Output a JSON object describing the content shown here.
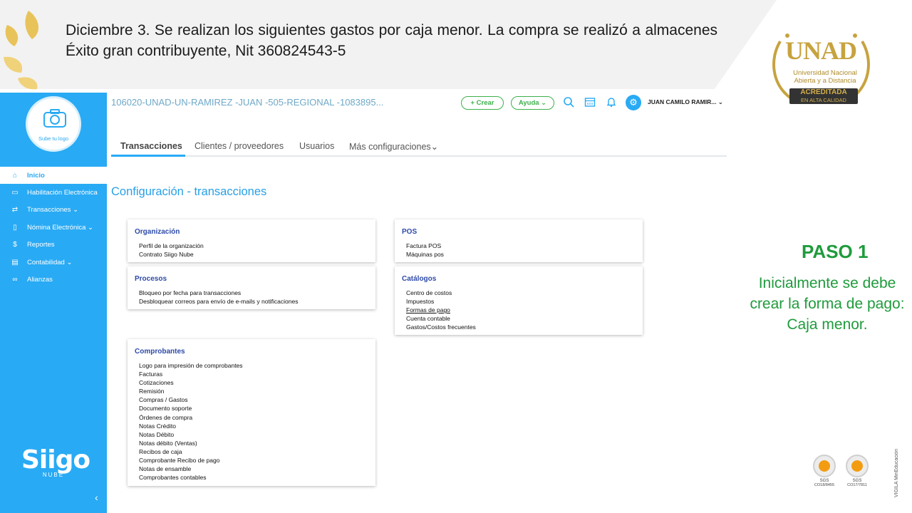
{
  "slide": {
    "title": "Diciembre 3. Se realizan los siguientes gastos por caja menor. La compra se realizó a almacenes Éxito gran contribuyente, Nit 360824543-5",
    "step_title": "PASO 1",
    "step_text": "Inicialmente se debe crear la forma de pago: Caja menor."
  },
  "unad_logo": {
    "brand": "UNAD",
    "subtitle": "Universidad Nacional Abierta y a Distancia",
    "badge_main": "ACREDITADA",
    "badge_sub": "EN ALTA CALIDAD"
  },
  "certifications": [
    {
      "label": "SGS",
      "code": "CO18/8455"
    },
    {
      "label": "SGS",
      "code": "CO17/7811"
    }
  ],
  "vertical_note": "VIGILA MinEducación",
  "app": {
    "logo_upload_label": "Sube tu logo",
    "org_title": "106020-UNAD-UN-RAMIREZ -JUAN -505-REGIONAL -1083895...",
    "crear_label": "+ Crear",
    "ayuda_label": "Ayuda ⌄",
    "user_name": "JUAN CAMILO RAMIR... ⌄",
    "brand": "Siigo",
    "brand_sub": "NUBE",
    "sidebar": [
      {
        "label": "Inicio",
        "icon": "home-icon",
        "active": true
      },
      {
        "label": "Habilitación Electrónica",
        "icon": "screen-icon"
      },
      {
        "label": "Transacciones ⌄",
        "icon": "exchange-icon"
      },
      {
        "label": "Nómina Electrónica ⌄",
        "icon": "document-icon"
      },
      {
        "label": "Reportes",
        "icon": "dollar-icon"
      },
      {
        "label": "Contabilidad ⌄",
        "icon": "ledger-icon"
      },
      {
        "label": "Alianzas",
        "icon": "link-icon"
      }
    ],
    "tabs": [
      {
        "label": "Transacciones",
        "active": true
      },
      {
        "label": "Clientes / proveedores"
      },
      {
        "label": "Usuarios"
      },
      {
        "label": "Más configuraciones⌄"
      }
    ],
    "page_heading": "Configuración - transacciones",
    "cards": {
      "organizacion": {
        "title": "Organización",
        "links": [
          "Perfil de la organización",
          "Contrato Siigo Nube"
        ]
      },
      "procesos": {
        "title": "Procesos",
        "links": [
          "Bloqueo por fecha para transacciones",
          "Desbloquear correos para envío de e-mails y notificaciones"
        ]
      },
      "comprobantes": {
        "title": "Comprobantes",
        "links": [
          "Logo para impresión de comprobantes",
          "Facturas",
          "Cotizaciones",
          "Remisión",
          "Compras / Gastos",
          "Documento soporte",
          "Órdenes de compra",
          "Notas Crédito",
          "Notas Débito",
          "Notas débito (Ventas)",
          "Recibos de caja",
          "Comprobante Recibo de pago",
          "Notas de ensamble",
          "Comprobantes contables"
        ]
      },
      "pos": {
        "title": "POS",
        "links": [
          "Factura POS",
          "Máquinas pos"
        ]
      },
      "catalogos": {
        "title": "Catálogos",
        "links": [
          "Centro de costos",
          "Impuestos",
          "Formas de pago",
          "Cuenta contable",
          "Gastos/Costos frecuentes"
        ]
      }
    }
  }
}
